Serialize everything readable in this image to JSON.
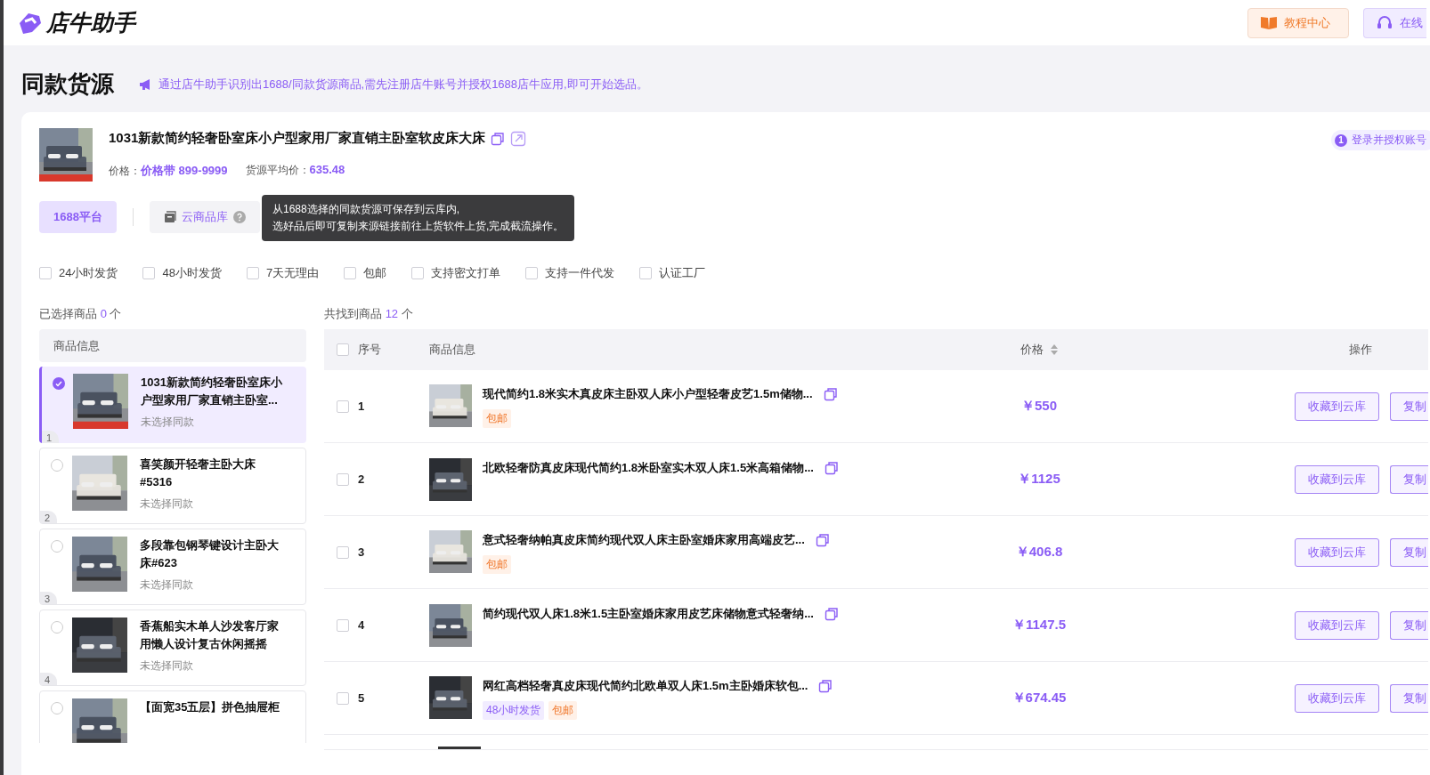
{
  "header": {
    "logo": "店牛助手",
    "buttons": [
      {
        "kind": "tutorial",
        "label": "教程中心"
      },
      {
        "kind": "service",
        "label": "在线"
      }
    ]
  },
  "page": {
    "title": "同款货源",
    "notice": "通过店牛助手识别出1688/同款货源商品,需先注册店牛账号并授权1688店牛应用,即可开始选品。"
  },
  "product": {
    "title": "1031新款简约轻奢卧室床小户型家用厂家直销主卧室软皮床大床",
    "price_label": "价格：",
    "price_value": "价格带 899-9999",
    "avg_label": "货源平均价：",
    "avg_value": "635.48",
    "step_badge": {
      "number": "1",
      "label": "登录并授权账号"
    }
  },
  "tabs": [
    {
      "label": "1688平台",
      "selected": true,
      "kind": "plain"
    },
    {
      "label": "云商品库",
      "selected": false,
      "kind": "cloud"
    }
  ],
  "tooltip": {
    "lines": [
      "从1688选择的同款货源可保存到云库内,",
      "选好品后即可复制来源链接前往上货软件上货,完成截流操作。"
    ]
  },
  "filters": [
    {
      "label": "24小时发货",
      "checked": false
    },
    {
      "label": "48小时发货",
      "checked": false
    },
    {
      "label": "7天无理由",
      "checked": false
    },
    {
      "label": "包邮",
      "checked": false
    },
    {
      "label": "支持密文打单",
      "checked": false
    },
    {
      "label": "支持一件代发",
      "checked": false
    },
    {
      "label": "认证工厂",
      "checked": false
    }
  ],
  "selected_panel": {
    "caption": "已选择商品",
    "count": "0",
    "unit": "个",
    "header": "商品信息",
    "items": [
      {
        "index": "1",
        "title": "1031新款简约轻奢卧室床小户型家用厂家直销主卧室...",
        "status": "未选择同款",
        "selected": true
      },
      {
        "index": "2",
        "title": "喜笑颜开轻奢主卧大床#5316",
        "status": "未选择同款",
        "selected": false
      },
      {
        "index": "3",
        "title": "多段靠包钢琴键设计主卧大床#623",
        "status": "未选择同款",
        "selected": false
      },
      {
        "index": "4",
        "title": "香蕉船实木单人沙发客厅家用懒人设计复古休闲摇摇",
        "status": "未选择同款",
        "selected": false
      },
      {
        "title": "【面宽35五层】拼色抽屉柜",
        "selected": false
      }
    ]
  },
  "results": {
    "caption": "共找到商品",
    "count": "12",
    "unit": "个",
    "columns": [
      "序号",
      "商品信息",
      "价格",
      "操作"
    ],
    "header_checked": false,
    "rows": [
      {
        "index": "1",
        "title": "现代简约1.8米实木真皮床主卧双人床小户型轻奢皮艺1.5m储物...",
        "tags": [
          {
            "kind": "free",
            "label": "包邮"
          }
        ],
        "price": "￥550",
        "checked": false,
        "actions": [
          "收藏到云库",
          "复制"
        ]
      },
      {
        "index": "2",
        "title": "北欧轻奢防真皮床现代简约1.8米卧室实木双人床1.5米高箱储物...",
        "tags": [],
        "price": "￥1125",
        "checked": false,
        "actions": [
          "收藏到云库",
          "复制"
        ]
      },
      {
        "index": "3",
        "title": "意式轻奢纳帕真皮床简约现代双人床主卧室婚床家用高端皮艺...",
        "tags": [
          {
            "kind": "free",
            "label": "包邮"
          }
        ],
        "price": "￥406.8",
        "checked": false,
        "actions": [
          "收藏到云库",
          "复制"
        ]
      },
      {
        "index": "4",
        "title": "简约现代双人床1.8米1.5主卧室婚床家用皮艺床储物意式轻奢纳...",
        "tags": [],
        "price": "￥1147.5",
        "checked": false,
        "actions": [
          "收藏到云库",
          "复制"
        ]
      },
      {
        "index": "5",
        "title": "网红高档轻奢真皮床现代简约北欧单双人床1.5m主卧婚床软包...",
        "tags": [
          {
            "kind": "shipping",
            "label": "48小时发货"
          },
          {
            "kind": "free",
            "label": "包邮"
          }
        ],
        "price": "￥674.45",
        "checked": false,
        "actions": [
          "收藏到云库",
          "复制"
        ]
      }
    ]
  }
}
